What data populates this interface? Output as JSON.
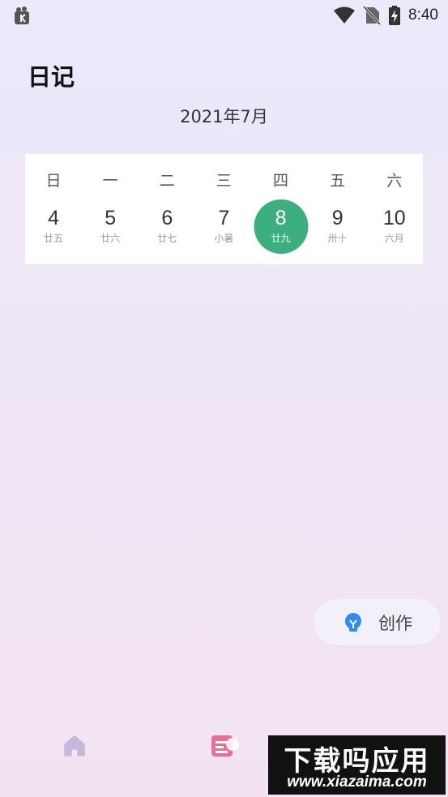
{
  "status_bar": {
    "time": "8:40",
    "icons": [
      "app-notification-icon",
      "wifi-icon",
      "no-sim-icon",
      "battery-charging-icon"
    ]
  },
  "header": {
    "title": "日记",
    "month": "2021年7月"
  },
  "calendar": {
    "weekdays": [
      "日",
      "一",
      "二",
      "三",
      "四",
      "五",
      "六"
    ],
    "days": [
      {
        "day": "4",
        "lunar": "廿五"
      },
      {
        "day": "5",
        "lunar": "廿六"
      },
      {
        "day": "6",
        "lunar": "廿七"
      },
      {
        "day": "7",
        "lunar": "小暑"
      },
      {
        "day": "8",
        "lunar": "廿九",
        "selected": true
      },
      {
        "day": "9",
        "lunar": "卅十"
      },
      {
        "day": "10",
        "lunar": "六月"
      }
    ],
    "accent_color": "#3DAE7E"
  },
  "create_button": {
    "label": "创作",
    "icon": "lightbulb-icon",
    "icon_color": "#2F8CF0"
  },
  "bottom_nav": {
    "items": [
      {
        "name": "home",
        "icon": "home-icon",
        "active": false
      },
      {
        "name": "diary",
        "icon": "diary-icon",
        "active": true
      }
    ],
    "active_color": "#F06A93",
    "inactive_color": "#C7B7DC"
  },
  "watermark": {
    "title": "下载吗应用",
    "url": "www.xiazaima.com"
  }
}
